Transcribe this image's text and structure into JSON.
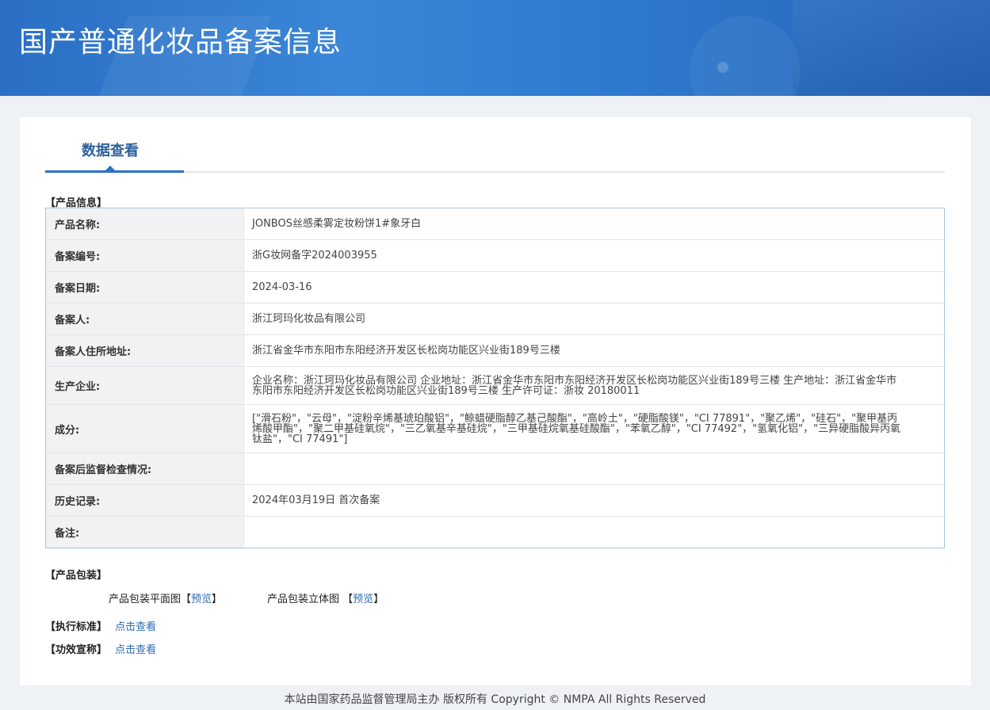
{
  "header": {
    "title": "国产普通化妆品备案信息"
  },
  "tabs": {
    "active_label": "数据查看"
  },
  "product_info": {
    "section_title": "【产品信息】",
    "rows": [
      {
        "label": "产品名称:",
        "value": "JONBOS丝感柔雾定妆粉饼1#象牙白"
      },
      {
        "label": "备案编号:",
        "value": "浙G妆网备字2024003955"
      },
      {
        "label": "备案日期:",
        "value": "2024-03-16"
      },
      {
        "label": "备案人:",
        "value": "浙江珂玛化妆品有限公司"
      },
      {
        "label": "备案人住所地址:",
        "value": "浙江省金华市东阳市东阳经济开发区长松岗功能区兴业街189号三楼"
      },
      {
        "label": "生产企业:",
        "value": "企业名称：浙江珂玛化妆品有限公司 企业地址：浙江省金华市东阳市东阳经济开发区长松岗功能区兴业街189号三楼 生产地址：浙江省金华市东阳市东阳经济开发区长松岗功能区兴业街189号三楼 生产许可证：浙妆 20180011"
      },
      {
        "label": "成分:",
        "value": "[\"滑石粉\"，\"云母\"，\"淀粉辛烯基琥珀酸铝\"，\"鲸蜡硬脂醇乙基己酸酯\"，\"高岭土\"，\"硬脂酸镁\"，\"CI 77891\"，\"聚乙烯\"，\"硅石\"，\"聚甲基丙烯酸甲酯\"，\"聚二甲基硅氧烷\"，\"三乙氧基辛基硅烷\"，\"三甲基硅烷氧基硅酸酯\"，\"苯氧乙醇\"，\"CI 77492\"，\"氢氧化铝\"，\"三异硬脂酸异丙氧钛盐\"，\"CI 77491\"]"
      },
      {
        "label": "备案后监督检查情况:",
        "value": ""
      },
      {
        "label": "历史记录:",
        "value": "2024年03月19日 首次备案"
      },
      {
        "label": "备注:",
        "value": ""
      }
    ]
  },
  "packaging": {
    "section_title": "【产品包装】",
    "flat_label": "产品包装平面图",
    "flat_link": "预览",
    "solid_label": "产品包装立体图",
    "solid_link": "预览",
    "bracket_open": "【",
    "bracket_close": "】"
  },
  "standard": {
    "section_title": "【执行标准】",
    "link": "点击查看"
  },
  "claims": {
    "section_title": "【功效宣称】",
    "link": "点击查看"
  },
  "footer": {
    "text": "本站由国家药品监督管理局主办 版权所有 Copyright © NMPA All Rights Reserved"
  }
}
